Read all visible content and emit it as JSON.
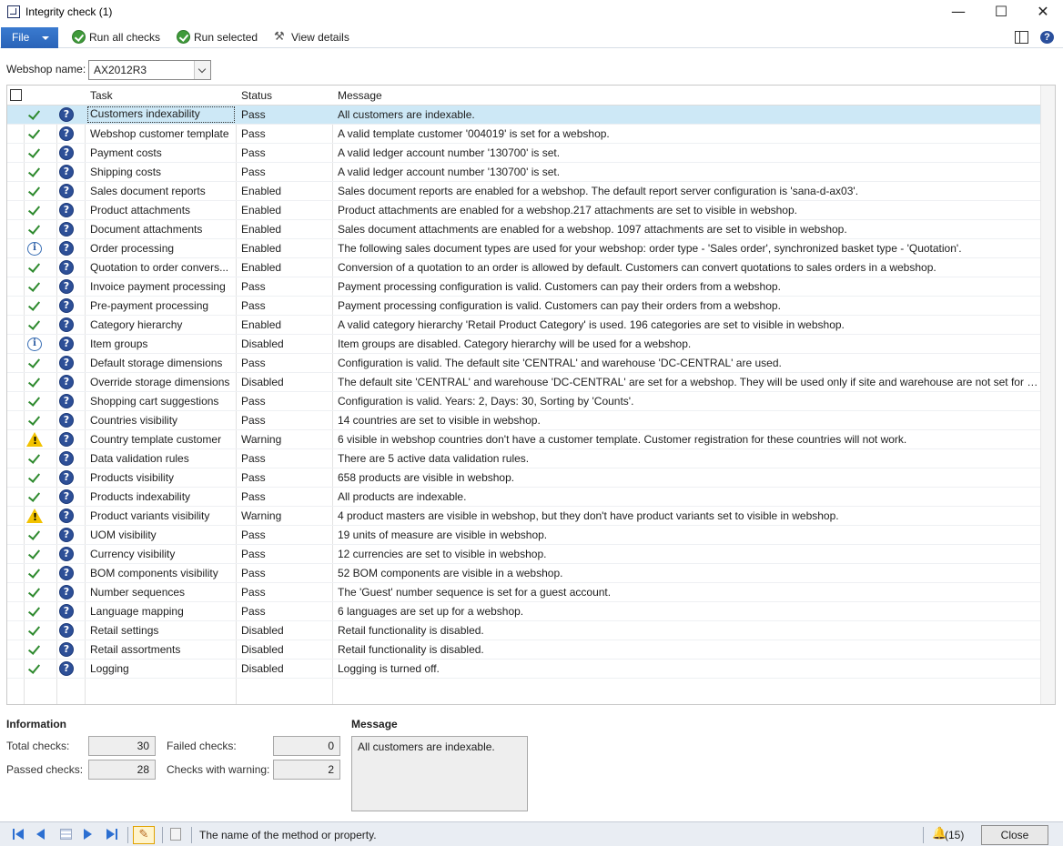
{
  "window": {
    "title": "Integrity check (1)",
    "minimize": "—",
    "maximize": "☐",
    "close": "✕"
  },
  "toolbar": {
    "file_label": "File",
    "run_all_label": "Run all checks",
    "run_selected_label": "Run selected",
    "view_details_label": "View details"
  },
  "webshop": {
    "label": "Webshop name:",
    "value": "AX2012R3"
  },
  "grid": {
    "columns": {
      "task": "Task",
      "status": "Status",
      "message": "Message"
    },
    "rows": [
      {
        "icon": "check",
        "task": "Customers indexability",
        "status": "Pass",
        "message": "All customers are indexable."
      },
      {
        "icon": "check",
        "task": "Webshop customer template",
        "status": "Pass",
        "message": "A valid template customer '004019' is set for a webshop."
      },
      {
        "icon": "check",
        "task": "Payment costs",
        "status": "Pass",
        "message": "A valid ledger account number '130700' is set."
      },
      {
        "icon": "check",
        "task": "Shipping costs",
        "status": "Pass",
        "message": "A valid ledger account number '130700' is set."
      },
      {
        "icon": "check",
        "task": "Sales document reports",
        "status": "Enabled",
        "message": "Sales document reports are enabled for a webshop. The default report server configuration is 'sana-d-ax03'."
      },
      {
        "icon": "check",
        "task": "Product attachments",
        "status": "Enabled",
        "message": "Product attachments are enabled for a webshop.217 attachments are set to visible in webshop."
      },
      {
        "icon": "check",
        "task": "Document attachments",
        "status": "Enabled",
        "message": "Sales document attachments are enabled for a webshop. 1097 attachments are set to visible in webshop."
      },
      {
        "icon": "info",
        "task": "Order processing",
        "status": "Enabled",
        "message": "The following sales document types are used for your webshop: order type - 'Sales order', synchronized basket type - 'Quotation'."
      },
      {
        "icon": "check",
        "task": "Quotation to order convers...",
        "status": "Enabled",
        "message": "Conversion of a quotation to an order is allowed by default. Customers can convert quotations to sales orders in a webshop."
      },
      {
        "icon": "check",
        "task": "Invoice payment processing",
        "status": "Pass",
        "message": "Payment processing configuration is valid. Customers can pay their orders from a webshop."
      },
      {
        "icon": "check",
        "task": "Pre-payment processing",
        "status": "Pass",
        "message": "Payment processing configuration is valid. Customers can pay their orders from a webshop."
      },
      {
        "icon": "check",
        "task": "Category hierarchy",
        "status": "Enabled",
        "message": "A valid category hierarchy 'Retail Product Category' is used. 196 categories are set to visible in webshop."
      },
      {
        "icon": "info",
        "task": "Item groups",
        "status": "Disabled",
        "message": "Item groups are disabled. Category hierarchy will be used for a webshop."
      },
      {
        "icon": "check",
        "task": "Default storage dimensions",
        "status": "Pass",
        "message": "Configuration is valid. The default site 'CENTRAL' and warehouse 'DC-CENTRAL' are used."
      },
      {
        "icon": "check",
        "task": "Override storage dimensions",
        "status": "Disabled",
        "message": "The default site 'CENTRAL' and warehouse 'DC-CENTRAL' are set for a webshop. They will be used only if site and warehouse are not set for a c..."
      },
      {
        "icon": "check",
        "task": "Shopping cart suggestions",
        "status": "Pass",
        "message": "Configuration is valid. Years: 2, Days: 30, Sorting by 'Counts'."
      },
      {
        "icon": "check",
        "task": "Countries visibility",
        "status": "Pass",
        "message": "14 countries are set to visible in webshop."
      },
      {
        "icon": "warning",
        "task": "Country template customer",
        "status": "Warning",
        "message": "6 visible in webshop countries don't have a customer template. Customer registration for these countries will not work."
      },
      {
        "icon": "check",
        "task": "Data validation rules",
        "status": "Pass",
        "message": "There are 5 active data validation rules."
      },
      {
        "icon": "check",
        "task": "Products visibility",
        "status": "Pass",
        "message": "658 products are visible in webshop."
      },
      {
        "icon": "check",
        "task": "Products indexability",
        "status": "Pass",
        "message": "All products are indexable."
      },
      {
        "icon": "warning",
        "task": "Product variants visibility",
        "status": "Warning",
        "message": "4 product masters are visible in webshop, but they don't have product variants set to visible in webshop."
      },
      {
        "icon": "check",
        "task": "UOM visibility",
        "status": "Pass",
        "message": "19 units of measure are visible in webshop."
      },
      {
        "icon": "check",
        "task": "Currency visibility",
        "status": "Pass",
        "message": "12 currencies are set to visible in webshop."
      },
      {
        "icon": "check",
        "task": "BOM components visibility",
        "status": "Pass",
        "message": "52 BOM components are visible in a webshop."
      },
      {
        "icon": "check",
        "task": "Number sequences",
        "status": "Pass",
        "message": "The 'Guest' number sequence is set for a guest account."
      },
      {
        "icon": "check",
        "task": "Language mapping",
        "status": "Pass",
        "message": "6 languages are set up for a webshop."
      },
      {
        "icon": "check",
        "task": "Retail settings",
        "status": "Disabled",
        "message": "Retail functionality is disabled."
      },
      {
        "icon": "check",
        "task": "Retail assortments",
        "status": "Disabled",
        "message": "Retail functionality is disabled."
      },
      {
        "icon": "check",
        "task": "Logging",
        "status": "Disabled",
        "message": "Logging is turned off."
      }
    ]
  },
  "info": {
    "title": "Information",
    "total_label": "Total checks:",
    "total_value": "30",
    "passed_label": "Passed checks:",
    "passed_value": "28",
    "failed_label": "Failed checks:",
    "failed_value": "0",
    "warning_label": "Checks with warning:",
    "warning_value": "2"
  },
  "message_panel": {
    "title": "Message",
    "text": "All customers are indexable."
  },
  "statusbar": {
    "text": "The name of the method or property.",
    "notifications": "(15)",
    "close_label": "Close"
  },
  "colors": {
    "accent": "#2a63b8",
    "selected_row": "#cde8f6",
    "pass": "#2e8a2e",
    "warning": "#f2c200"
  }
}
